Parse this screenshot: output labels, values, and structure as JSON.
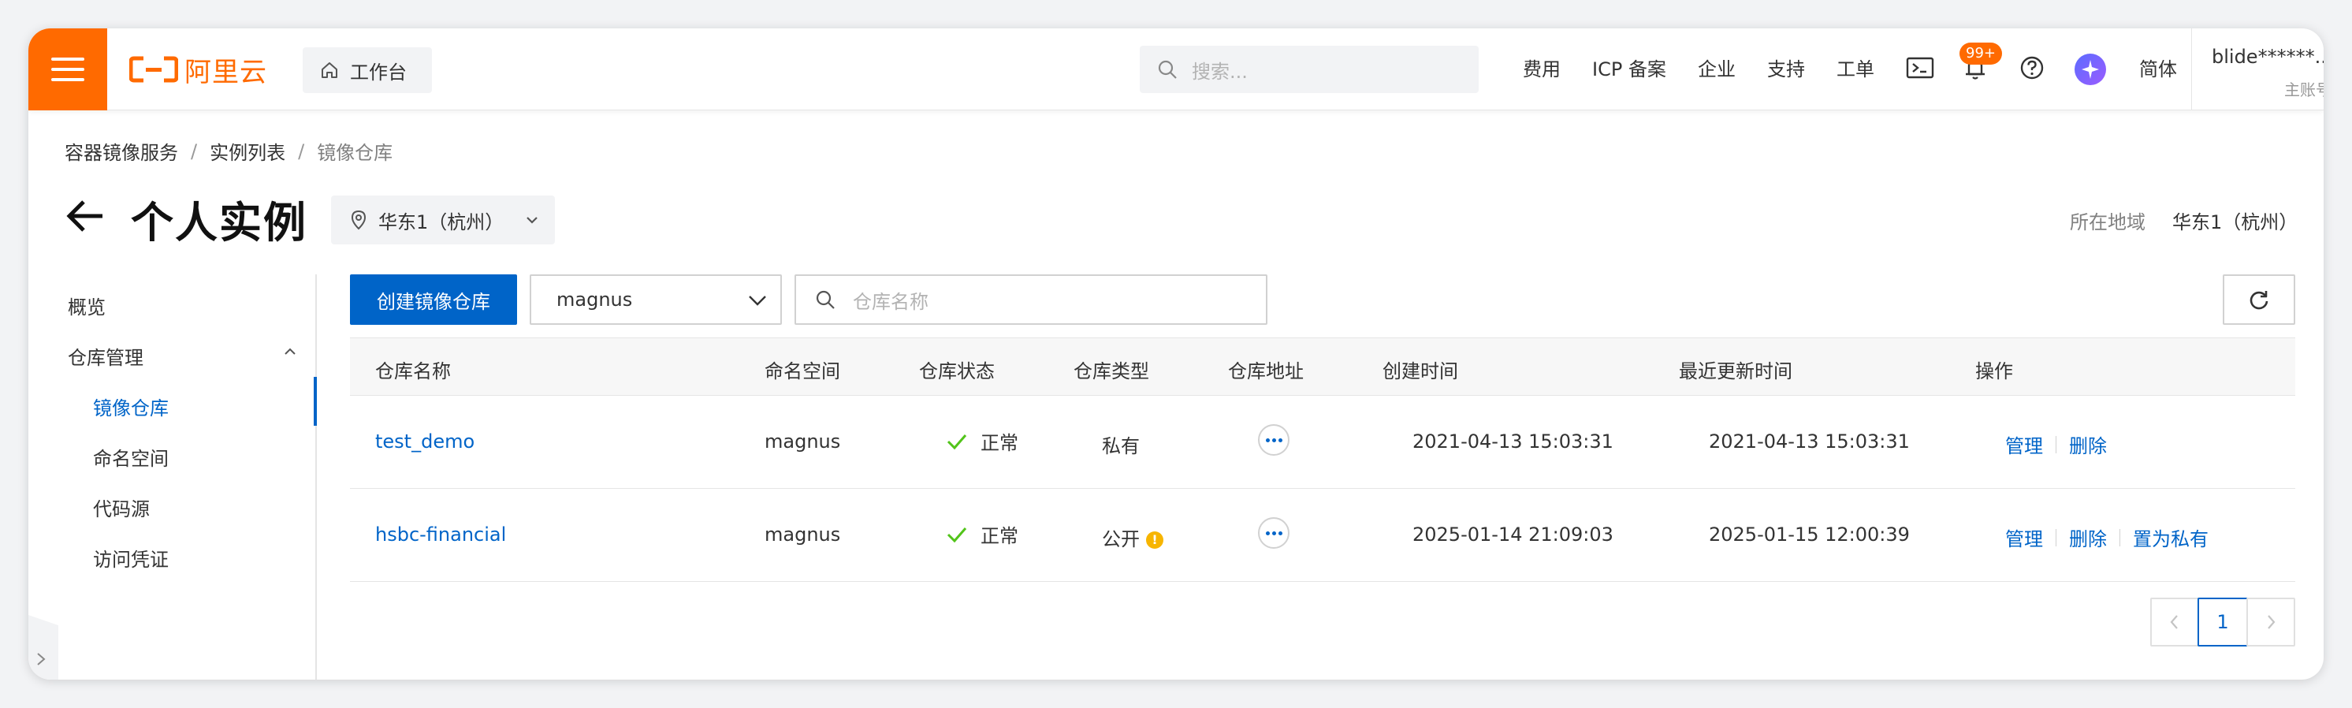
{
  "header": {
    "logo_text": "阿里云",
    "workbench_label": "工作台",
    "search_placeholder": "搜索...",
    "nav": [
      "费用",
      "ICP 备案",
      "企业",
      "支持",
      "工单"
    ],
    "notification_badge": "99+",
    "language": "简体",
    "account_name": "blide******...",
    "account_sub": "主账号"
  },
  "breadcrumb": [
    "容器镜像服务",
    "实例列表",
    "镜像仓库"
  ],
  "title": "个人实例",
  "region_selector": "华东1（杭州）",
  "region_info": {
    "label": "所在地域",
    "value": "华东1（杭州）"
  },
  "sidebar": {
    "overview": "概览",
    "repo_management": "仓库管理",
    "items": [
      "镜像仓库",
      "命名空间",
      "代码源",
      "访问凭证"
    ],
    "active_item": "镜像仓库"
  },
  "toolbar": {
    "create_label": "创建镜像仓库",
    "namespace_value": "magnus",
    "search_placeholder": "仓库名称"
  },
  "table": {
    "columns": [
      "仓库名称",
      "命名空间",
      "仓库状态",
      "仓库类型",
      "仓库地址",
      "创建时间",
      "最近更新时间",
      "操作"
    ],
    "rows": [
      {
        "name": "test_demo",
        "namespace": "magnus",
        "status": "正常",
        "type": "私有",
        "type_warning": false,
        "created": "2021-04-13 15:03:31",
        "updated": "2021-04-13 15:03:31",
        "actions": [
          "管理",
          "删除"
        ]
      },
      {
        "name": "hsbc-financial",
        "namespace": "magnus",
        "status": "正常",
        "type": "公开",
        "type_warning": true,
        "created": "2025-01-14 21:09:03",
        "updated": "2025-01-15 12:00:39",
        "actions": [
          "管理",
          "删除",
          "置为私有"
        ]
      }
    ]
  },
  "pagination": {
    "current_page": "1"
  },
  "colors": {
    "brand_orange": "#ff6a00",
    "primary_blue": "#0064c8",
    "success_green": "#52c41a",
    "warning_yellow": "#f7b500"
  }
}
